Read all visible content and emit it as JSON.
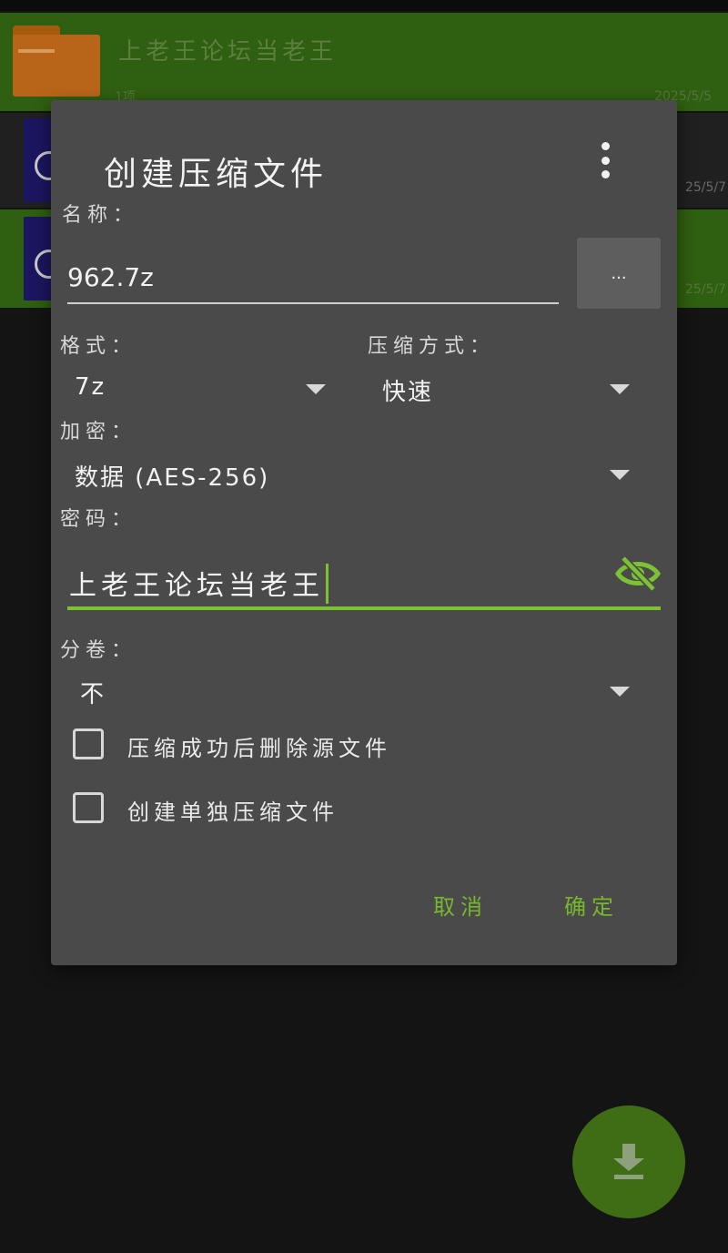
{
  "background_list": {
    "row1": {
      "title": "上老王论坛当老王",
      "subtitle": "1项",
      "date": "2025/5/5"
    },
    "row2": {
      "date": "25/5/7"
    },
    "row3": {
      "date": "25/5/7"
    }
  },
  "dialog": {
    "title": "创建压缩文件",
    "name_label": "名称：",
    "name_value": "962.7z",
    "browse_label": "...",
    "format_label": "格式：",
    "format_value": "7z",
    "method_label": "压缩方式：",
    "method_value": "快速",
    "encryption_label": "加密：",
    "encryption_value": "数据 (AES-256)",
    "password_label": "密码：",
    "password_value": "上老王论坛当老王",
    "split_label": "分卷：",
    "split_value": "不",
    "delete_source_label": "压缩成功后删除源文件",
    "separate_archive_label": "创建单独压缩文件",
    "cancel_label": "取消",
    "ok_label": "确定"
  },
  "colors": {
    "accent": "#7cc233",
    "dialog_bg": "#4a4a4a",
    "row_highlight": "#2f5f10"
  },
  "icons": {
    "menu": "more-vertical-icon",
    "password_toggle": "eye-off-icon",
    "fab": "download-icon"
  }
}
